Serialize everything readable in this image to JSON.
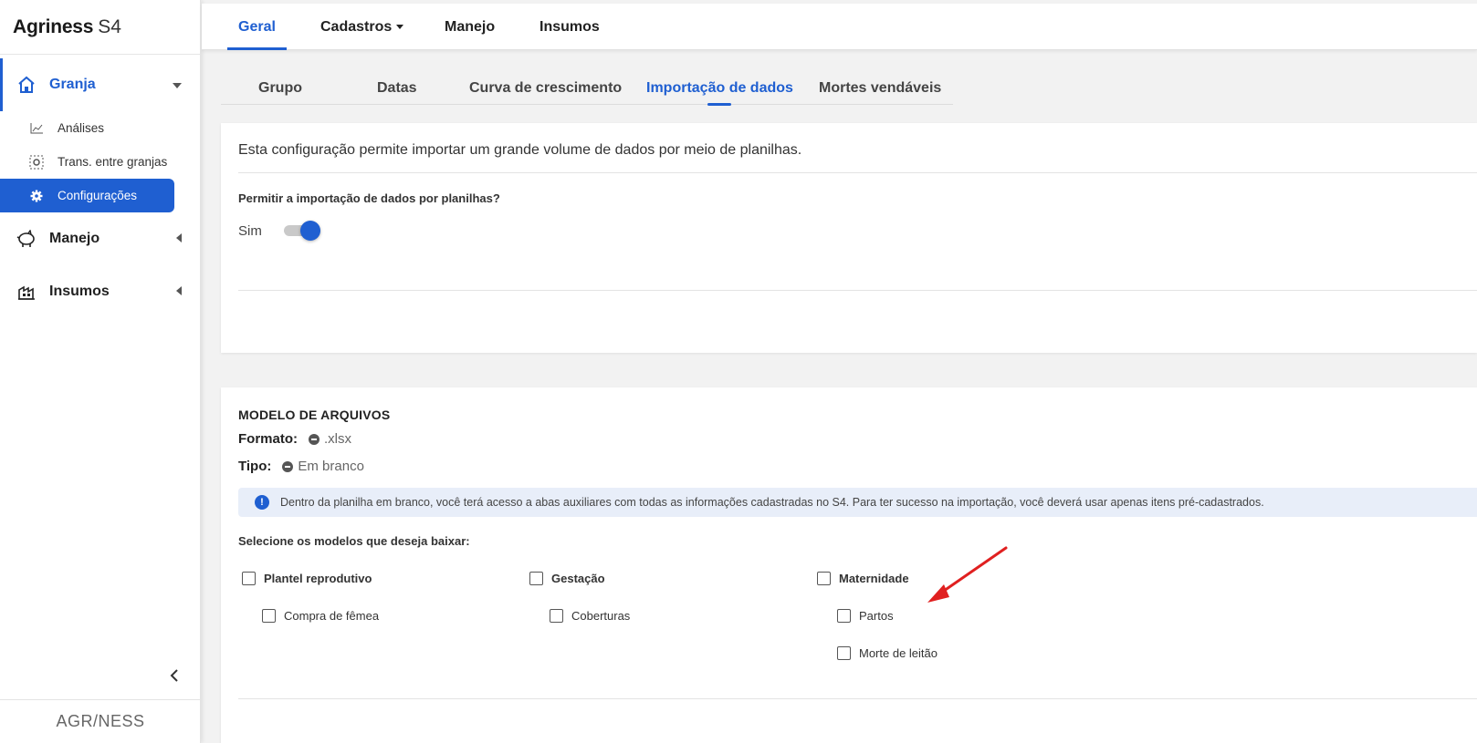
{
  "sidebar": {
    "brand_bold": "Agriness",
    "brand_rest": "S4",
    "groups": [
      {
        "label": "Granja"
      },
      {
        "label": "Manejo"
      },
      {
        "label": "Insumos"
      }
    ],
    "granja_items": [
      {
        "label": "Análises"
      },
      {
        "label": "Trans. entre granjas"
      },
      {
        "label": "Configurações"
      }
    ],
    "footer": "AGR/NESS"
  },
  "topnav": {
    "tabs": [
      {
        "label": "Geral"
      },
      {
        "label": "Cadastros"
      },
      {
        "label": "Manejo"
      },
      {
        "label": "Insumos"
      }
    ],
    "active": "Geral"
  },
  "subtabs": {
    "tabs": [
      {
        "label": "Grupo"
      },
      {
        "label": "Datas"
      },
      {
        "label": "Curva de crescimento"
      },
      {
        "label": "Importação de dados"
      },
      {
        "label": "Mortes vendáveis"
      }
    ],
    "active": "Importação de dados"
  },
  "import_card": {
    "description": "Esta configuração permite importar um grande volume de dados por meio de planilhas.",
    "question": "Permitir a importação de dados por planilhas?",
    "toggle_value": "Sim",
    "toggle_on": true
  },
  "models_card": {
    "title": "MODELO DE ARQUIVOS",
    "format_label": "Formato:",
    "format_value": ".xlsx",
    "type_label": "Tipo:",
    "type_value": "Em branco",
    "info_text": "Dentro da planilha em branco, você terá acesso a abas auxiliares com todas as informações cadastradas no S4. Para ter sucesso na importação, você deverá usar apenas itens pré-cadastrados.",
    "select_label": "Selecione os modelos que deseja baixar:",
    "groups": [
      {
        "label": "Plantel reprodutivo",
        "checked": false,
        "items": [
          {
            "label": "Compra de fêmea",
            "checked": false
          }
        ]
      },
      {
        "label": "Gestação",
        "checked": false,
        "items": [
          {
            "label": "Coberturas",
            "checked": false
          }
        ]
      },
      {
        "label": "Maternidade",
        "checked": false,
        "items": [
          {
            "label": "Partos",
            "checked": false
          },
          {
            "label": "Morte de leitão",
            "checked": false
          }
        ]
      }
    ]
  },
  "colors": {
    "primary": "#1f5fd1",
    "annotation_arrow": "#e02020"
  }
}
